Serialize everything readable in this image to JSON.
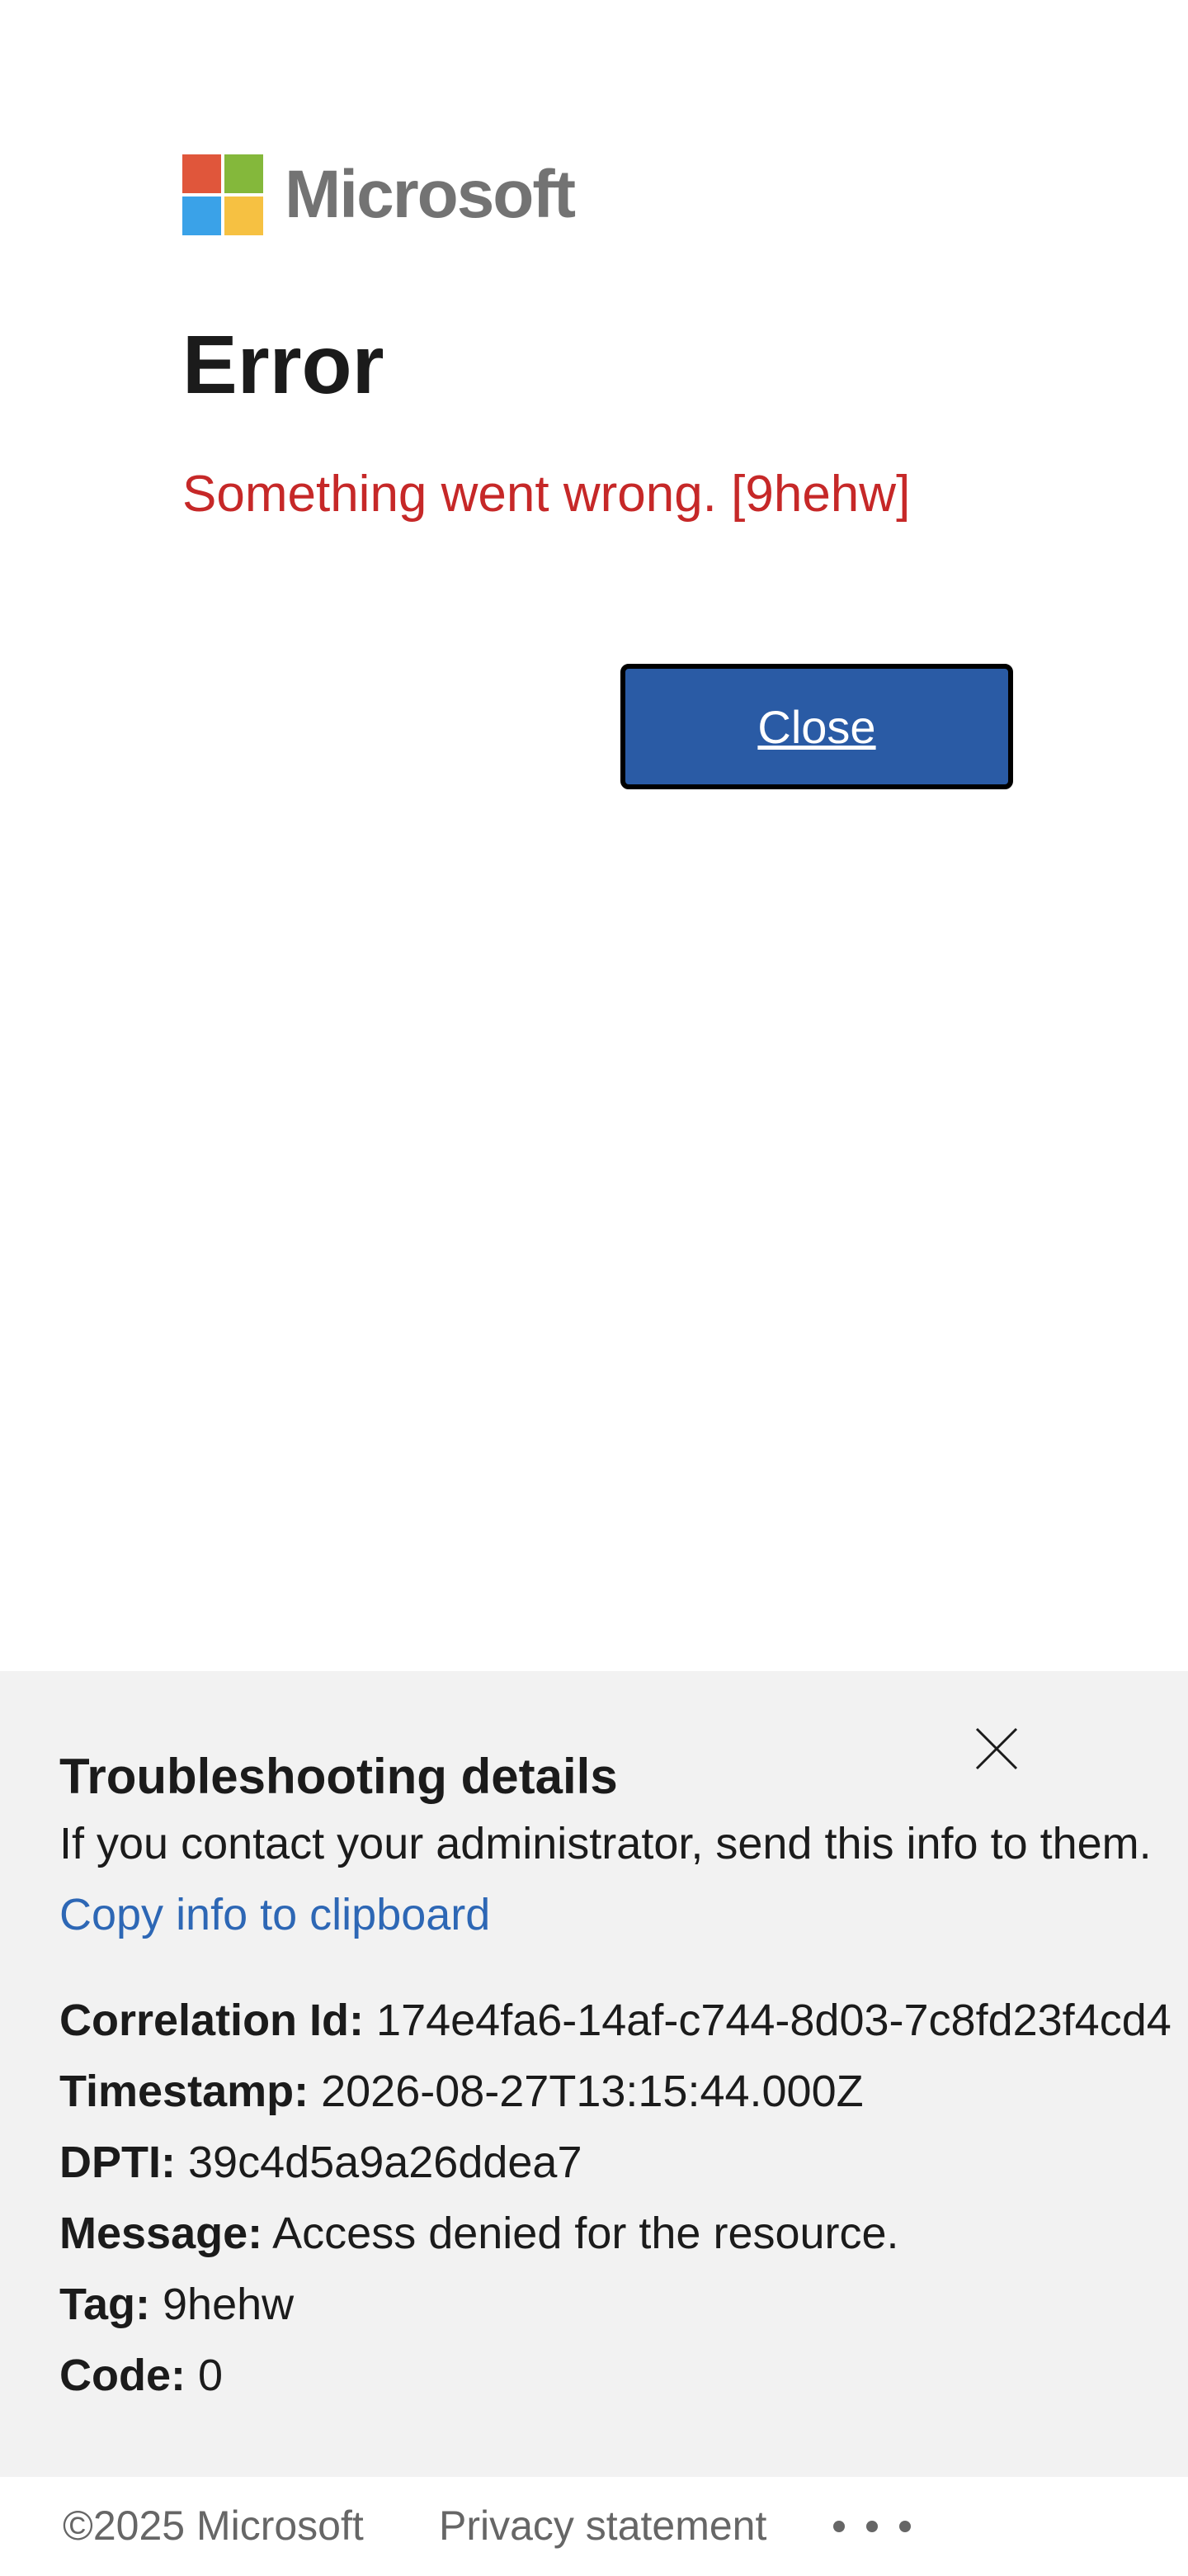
{
  "brand": {
    "name": "Microsoft",
    "colors": {
      "red": "#f25022",
      "green": "#7fba00",
      "blue": "#00a4ef",
      "yellow": "#ffb900"
    }
  },
  "error": {
    "title": "Error",
    "message": "Something went wrong. [9hehw]",
    "message_color": "#c62828",
    "close_label": "Close",
    "close_color": "#2a5ba5"
  },
  "troubleshooting": {
    "title": "Troubleshooting details",
    "description": "If you contact your administrator, send this info to them.",
    "copy_link": "Copy info to clipboard",
    "close_icon": "close-icon",
    "details": [
      {
        "label": "Correlation Id:",
        "value": "174e4fa6-14af-c744-8d03-7c8fd23f4cd4"
      },
      {
        "label": "Timestamp:",
        "value": "2026-08-27T13:15:44.000Z"
      },
      {
        "label": "DPTI:",
        "value": "39c4d5a9a26ddea7"
      },
      {
        "label": "Message:",
        "value": "Access denied for the resource."
      },
      {
        "label": "Tag:",
        "value": "9hehw"
      },
      {
        "label": "Code:",
        "value": "0"
      }
    ]
  },
  "footer": {
    "copyright": "©2025 Microsoft",
    "privacy": "Privacy statement",
    "more_icon": "more-options-icon"
  }
}
